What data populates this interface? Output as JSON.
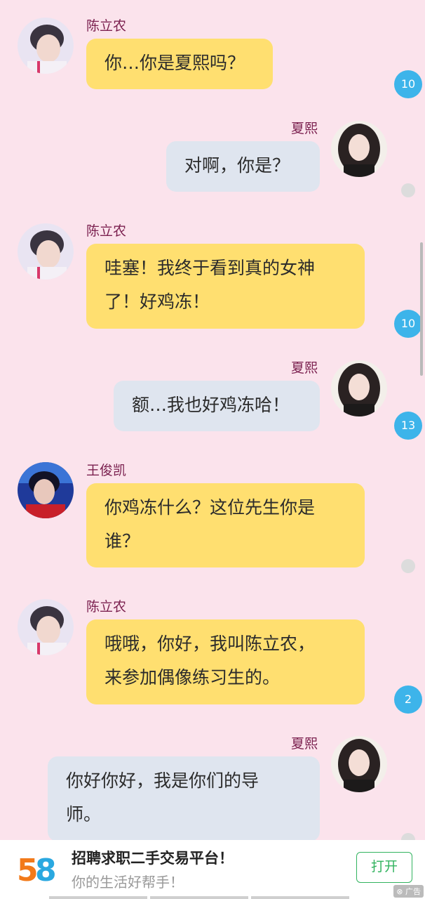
{
  "messages": [
    {
      "sender": "陈立农",
      "text_lines": [
        "你…你是夏熙吗？"
      ],
      "side": "left",
      "badge": "10",
      "avatar": "boy-avatar"
    },
    {
      "sender": "夏熙",
      "text_lines": [
        "对啊，你是？"
      ],
      "side": "right",
      "badge": "",
      "avatar": "girl-avatar"
    },
    {
      "sender": "陈立农",
      "text_lines": [
        "哇塞！我终于看到真的女神",
        "了！好鸡冻！"
      ],
      "side": "left",
      "badge": "10",
      "avatar": "boy-avatar"
    },
    {
      "sender": "夏熙",
      "text_lines": [
        "额…我也好鸡冻哈！"
      ],
      "side": "right",
      "badge": "13",
      "avatar": "girl-avatar"
    },
    {
      "sender": "王俊凯",
      "text_lines": [
        "你鸡冻什么？这位先生你是",
        "谁？"
      ],
      "side": "left",
      "badge": "",
      "avatar": "boy2-avatar"
    },
    {
      "sender": "陈立农",
      "text_lines": [
        "哦哦，你好，我叫陈立农，",
        "来参加偶像练习生的。"
      ],
      "side": "left",
      "badge": "2",
      "avatar": "boy-avatar"
    },
    {
      "sender": "夏熙",
      "text_lines": [
        "你好你好，我是你们的导",
        "师。"
      ],
      "side": "right",
      "badge": "",
      "avatar": "girl-avatar"
    }
  ],
  "ad": {
    "logo_text": "58",
    "title": "招聘求职二手交易平台！",
    "subtitle": "你的生活好帮手！",
    "button": "打开",
    "tag": "广告"
  },
  "colors": {
    "background": "#fbe3ec",
    "left_bubble": "#ffdf70",
    "right_bubble": "#dfe5ef",
    "badge": "#3db4ea",
    "sender_name": "#7a1f4e",
    "ad_button": "#32b35f"
  }
}
